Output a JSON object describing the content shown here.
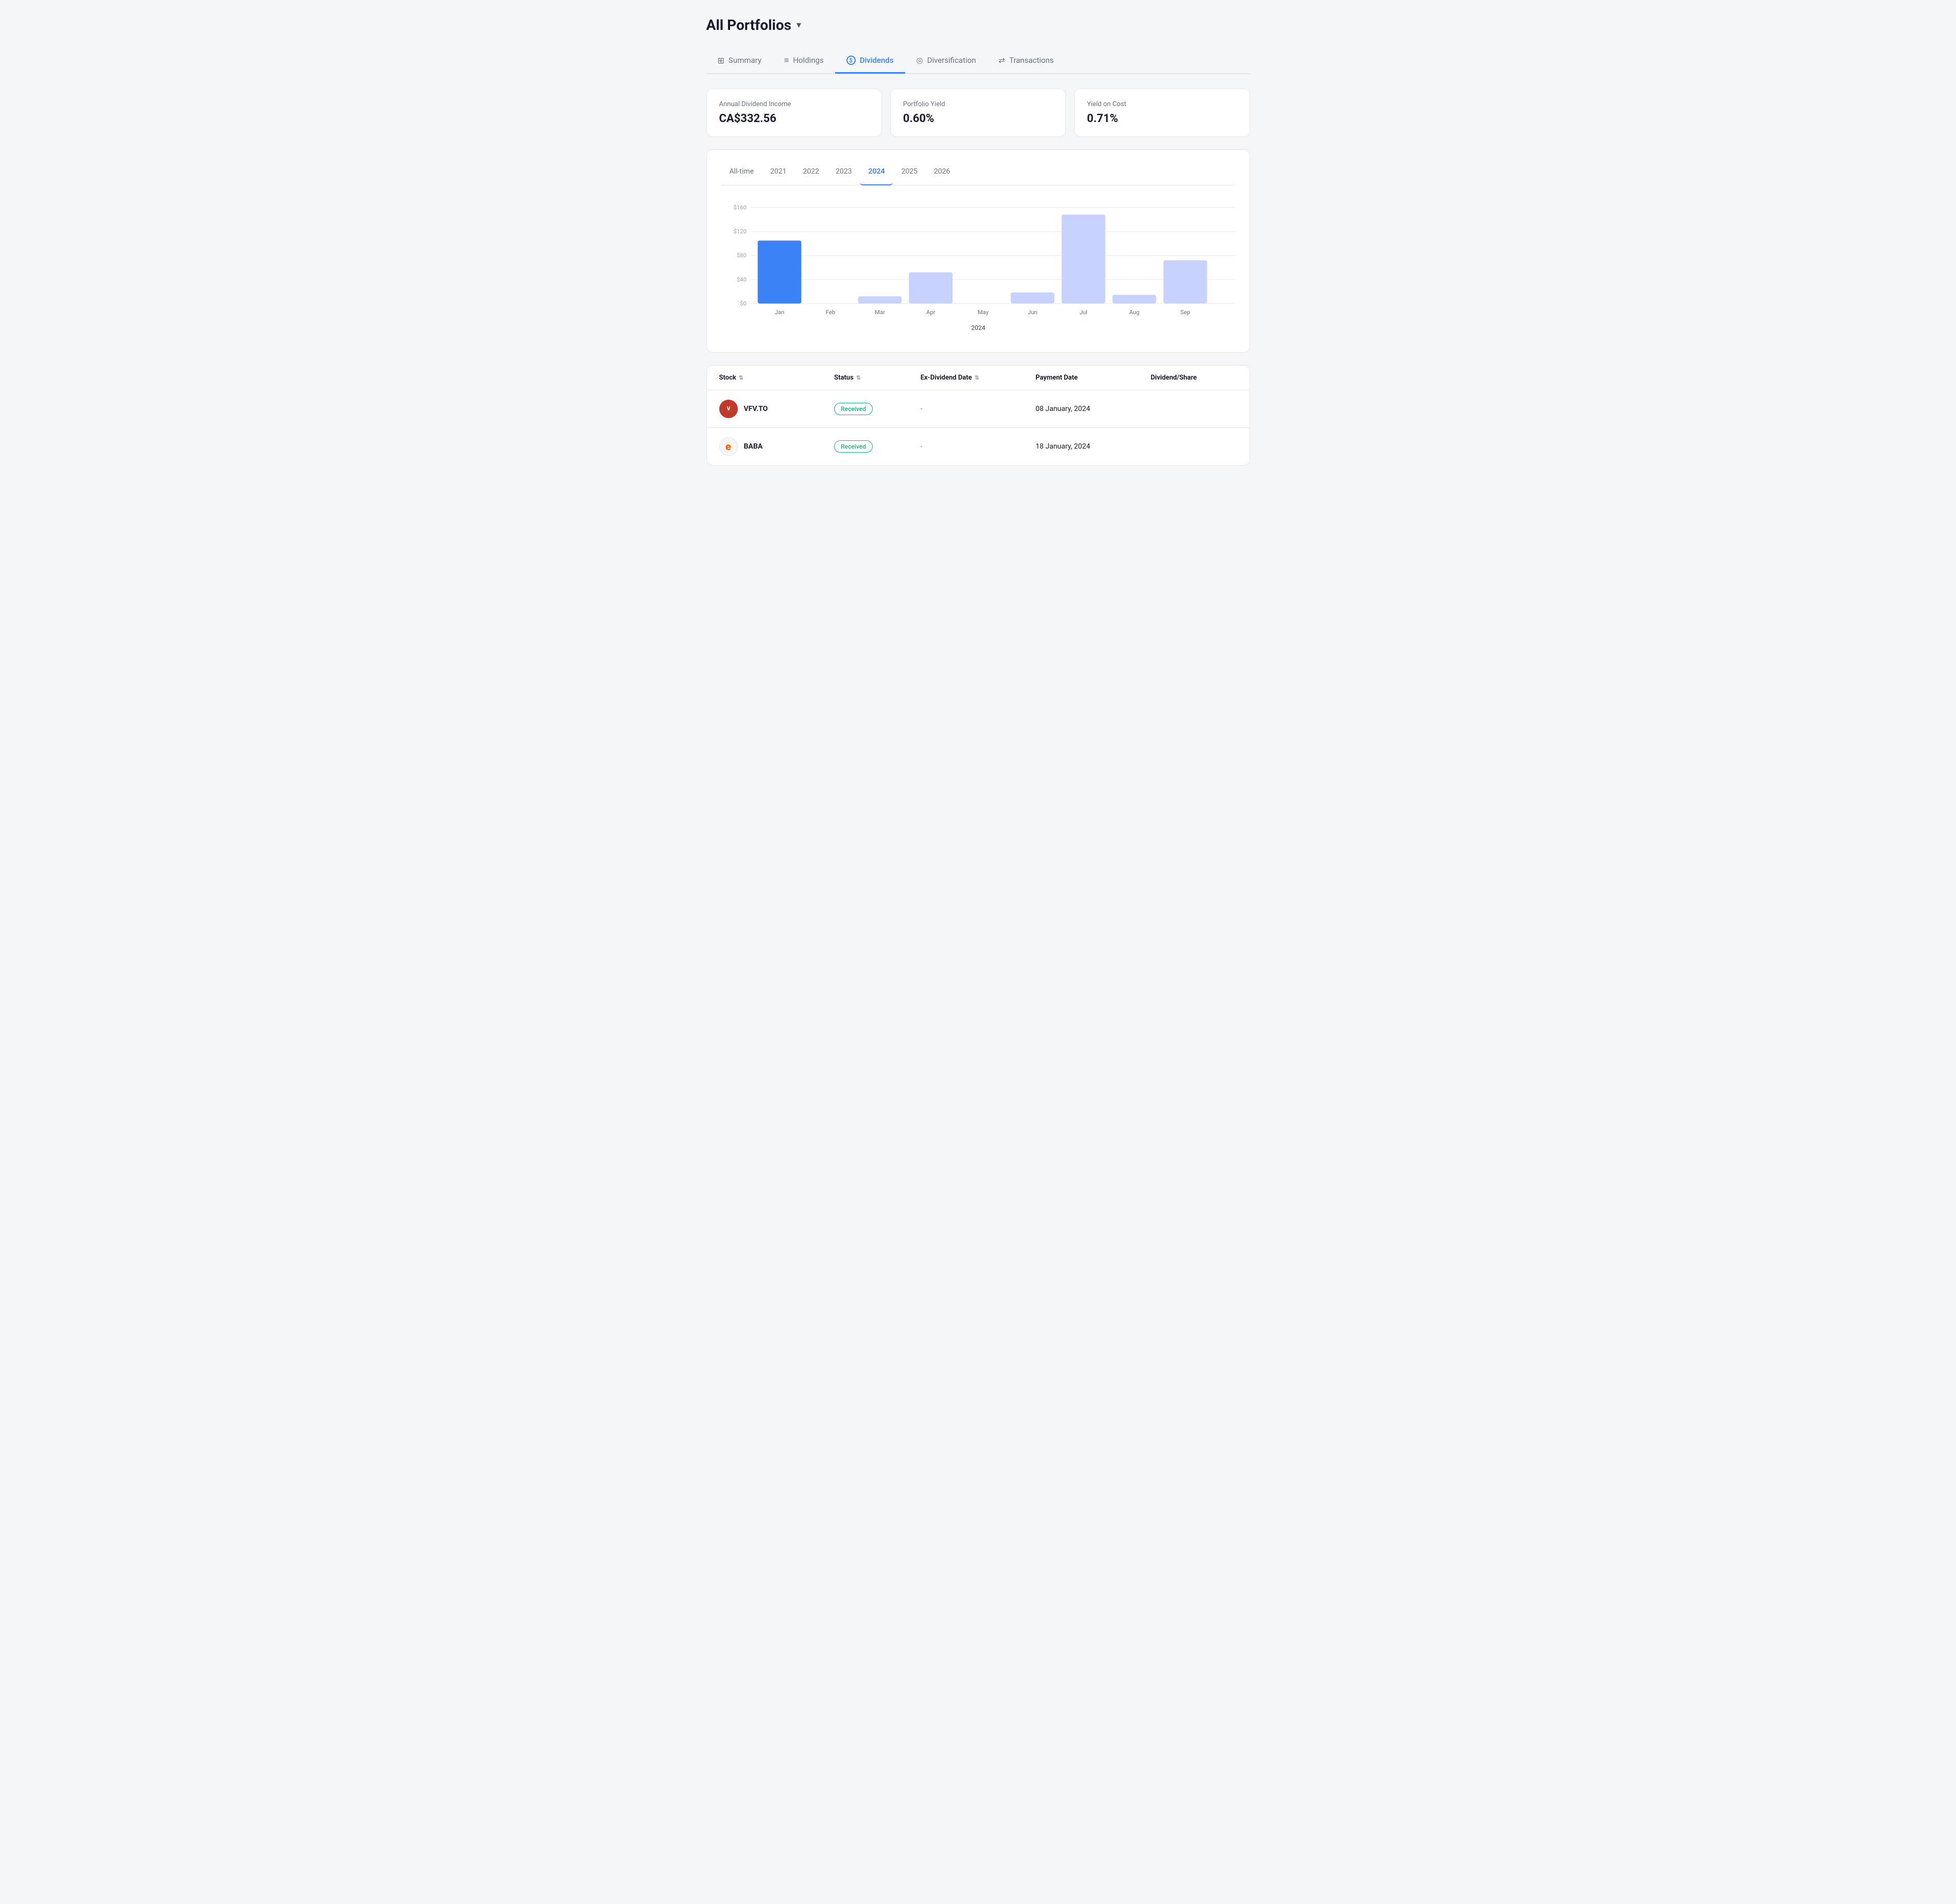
{
  "header": {
    "title": "All Portfolios",
    "dropdown_label": "▾"
  },
  "nav": {
    "tabs": [
      {
        "id": "summary",
        "label": "Summary",
        "icon": "⊞",
        "active": false
      },
      {
        "id": "holdings",
        "label": "Holdings",
        "icon": "≡",
        "active": false
      },
      {
        "id": "dividends",
        "label": "Dividends",
        "icon": "$",
        "active": true
      },
      {
        "id": "diversification",
        "label": "Diversification",
        "icon": "◎",
        "active": false
      },
      {
        "id": "transactions",
        "label": "Transactions",
        "icon": "⇄",
        "active": false
      }
    ]
  },
  "metrics": {
    "annual_income": {
      "label": "Annual Dividend Income",
      "value": "CA$332.56"
    },
    "portfolio_yield": {
      "label": "Portfolio Yield",
      "value": "0.60%"
    },
    "yield_on_cost": {
      "label": "Yield on Cost",
      "value": "0.71%"
    }
  },
  "chart": {
    "year_tabs": [
      "All-time",
      "2021",
      "2022",
      "2023",
      "2024",
      "2025",
      "2026"
    ],
    "active_year": "2024",
    "x_label": "2024",
    "y_labels": [
      "$160",
      "$120",
      "$80",
      "$40",
      "$0"
    ],
    "bars": [
      {
        "month": "Jan",
        "value": 105,
        "active": true
      },
      {
        "month": "Feb",
        "value": 0,
        "active": false
      },
      {
        "month": "Mar",
        "value": 12,
        "active": false
      },
      {
        "month": "Apr",
        "value": 52,
        "active": false
      },
      {
        "month": "May",
        "value": 0,
        "active": false
      },
      {
        "month": "Jun",
        "value": 18,
        "active": false
      },
      {
        "month": "Jul",
        "value": 148,
        "active": false
      },
      {
        "month": "Aug",
        "value": 14,
        "active": false
      },
      {
        "month": "Sep",
        "value": 72,
        "active": false
      }
    ],
    "max_value": 160
  },
  "table": {
    "columns": [
      {
        "id": "stock",
        "label": "Stock",
        "sortable": true
      },
      {
        "id": "status",
        "label": "Status",
        "sortable": true
      },
      {
        "id": "ex_dividend_date",
        "label": "Ex-Dividend Date",
        "sortable": true
      },
      {
        "id": "payment_date",
        "label": "Payment Date",
        "sortable": false
      },
      {
        "id": "dividend",
        "label": "Dividend/Share",
        "sortable": false
      }
    ],
    "rows": [
      {
        "ticker": "VFV.TO",
        "logo_type": "vfv",
        "logo_text": "V",
        "status": "Received",
        "ex_dividend_date": "-",
        "payment_date": "08 January, 2024",
        "dividend": ""
      },
      {
        "ticker": "BABA",
        "logo_type": "baba",
        "logo_text": "e",
        "status": "Received",
        "ex_dividend_date": "-",
        "payment_date": "18 January, 2024",
        "dividend": ""
      }
    ]
  }
}
